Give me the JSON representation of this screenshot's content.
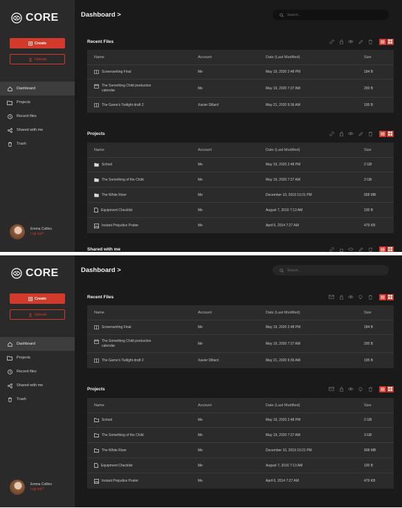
{
  "app": {
    "logo_text": "CORE"
  },
  "sidebar": {
    "create_label": "Create",
    "upload_label": "Upload",
    "items": [
      {
        "label": "Dashboard",
        "icon": "home-icon"
      },
      {
        "label": "Projects",
        "icon": "folder-icon"
      },
      {
        "label": "Recent files",
        "icon": "clock-icon"
      },
      {
        "label": "Shared with me",
        "icon": "share-icon"
      },
      {
        "label": "Trash",
        "icon": "trash-icon"
      }
    ],
    "user": {
      "name": "Emma Collins",
      "logout": "Log out?"
    }
  },
  "header": {
    "title": "Dashboard >",
    "search_placeholder": "Search..."
  },
  "columns": {
    "name": "Name",
    "account": "Account",
    "date": "Date (Last Modified)",
    "size": "Size"
  },
  "recent_files": {
    "title": "Recent Files",
    "rows": [
      {
        "icon": "document-icon",
        "name": "Screenwriting Final",
        "name2": "",
        "account": "Me",
        "date": "May 19, 2020 2:48 PM",
        "size": "184 B"
      },
      {
        "icon": "calendar-icon",
        "name": "The Something Child production",
        "name2": "calendar",
        "account": "Me",
        "date": "May 19, 2020 7:27 AM",
        "size": "200 B"
      },
      {
        "icon": "document-icon",
        "name": "The Game's Twilight draft 2",
        "name2": "",
        "account": "Xavier Dillard",
        "date": "May 21, 2020 9:36 AM",
        "size": "195 B"
      }
    ]
  },
  "projects": {
    "title": "Projects",
    "rows": [
      {
        "icon": "folder-icon",
        "name": "School",
        "account": "Me",
        "date": "May 19, 2020 2:48 PM",
        "size": "2 GB"
      },
      {
        "icon": "folder-icon",
        "name": "The Something of the Child",
        "account": "Me",
        "date": "May 19, 2020 7:27 AM",
        "size": "3 GB"
      },
      {
        "icon": "folder-icon",
        "name": "The White River",
        "account": "Me",
        "date": "December 10, 2019 10:21 PM",
        "size": "908 MB"
      },
      {
        "icon": "file-icon",
        "name": "Equipment Checklist",
        "account": "Me",
        "date": "August 7, 2016 7:13 AM",
        "size": "100 B"
      },
      {
        "icon": "image-icon",
        "name": "Instant Prejudice Poster",
        "account": "Me",
        "date": "April 6, 2014 7:27 AM",
        "size": "479 KB"
      }
    ]
  },
  "shared": {
    "title": "Shared with me"
  },
  "colors": {
    "accent": "#d23a2c",
    "background": "#1a1a1a",
    "sidebar": "#2a2a2a",
    "panel": "#2b2b2b"
  }
}
